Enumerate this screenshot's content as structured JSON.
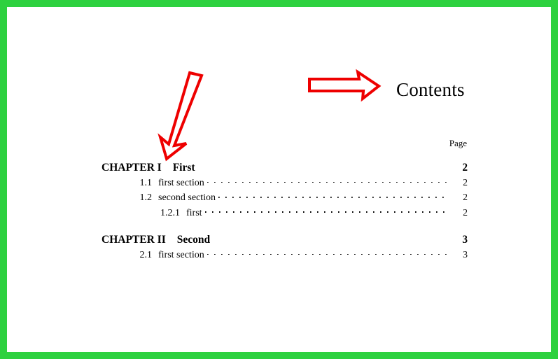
{
  "document": {
    "title": "Contents",
    "page_column_header": "Page"
  },
  "toc": {
    "entries": [
      {
        "kind": "chapter",
        "label": "CHAPTER I",
        "title": "First",
        "page": "2"
      },
      {
        "kind": "section",
        "level": 1,
        "number": "1.1",
        "title": "first section",
        "page": "2"
      },
      {
        "kind": "section",
        "level": 1,
        "number": "1.2",
        "title": "second section",
        "page": "2"
      },
      {
        "kind": "section",
        "level": 2,
        "number": "1.2.1",
        "title": "first",
        "page": "2"
      },
      {
        "kind": "chapter",
        "label": "CHAPTER II",
        "title": "Second",
        "page": "3"
      },
      {
        "kind": "section",
        "level": 1,
        "number": "2.1",
        "title": "first section",
        "page": "3"
      }
    ]
  },
  "annotations": {
    "arrow_color": "#ee0000",
    "items": [
      {
        "name": "arrow-right-to-contents-title",
        "direction": "right"
      },
      {
        "name": "arrow-down-to-chapter-one",
        "direction": "down"
      }
    ]
  },
  "frame": {
    "border_color": "#2ed13f",
    "background_color": "#ffffff"
  }
}
